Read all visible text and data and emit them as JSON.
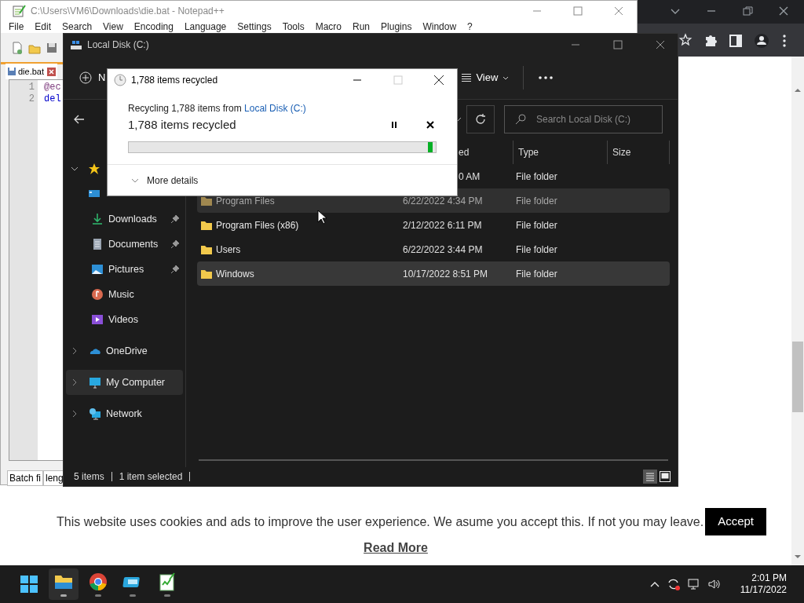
{
  "notepad": {
    "title": "C:\\Users\\VM6\\Downloads\\die.bat - Notepad++",
    "menu": [
      "File",
      "Edit",
      "Search",
      "View",
      "Encoding",
      "Language",
      "Settings",
      "Tools",
      "Macro",
      "Run",
      "Plugins",
      "Window",
      "?"
    ],
    "tab": {
      "label": "die.bat"
    },
    "lines": [
      {
        "number": "1",
        "code": "@ec"
      },
      {
        "number": "2",
        "code": "del"
      }
    ],
    "status": [
      "Batch fi",
      "leng"
    ]
  },
  "cookie_banner": {
    "text": "This website uses cookies and ads to improve the user experience. We asume you accept this. If not you may leave.",
    "button": "Accept",
    "link": "Read More"
  },
  "explorer": {
    "title": "Local Disk (C:)",
    "commands": [
      {
        "kind": "new",
        "label": "N"
      },
      {
        "kind": "view",
        "label": "View"
      },
      {
        "kind": "more"
      }
    ],
    "search": {
      "placeholder": "Search Local Disk (C:)"
    },
    "columns": [
      "ed",
      "Type",
      "Size"
    ],
    "rows": [
      {
        "date": "0 AM",
        "type": "File folder",
        "selected": false,
        "hovered": false,
        "dimmed": false
      },
      {
        "name": "Program Files",
        "date": "6/22/2022 4:34 PM",
        "type": "File folder",
        "selected": false,
        "hovered": true,
        "dimmed": true
      },
      {
        "name": "Program Files (x86)",
        "date": "2/12/2022 6:11 PM",
        "type": "File folder",
        "selected": false,
        "hovered": false,
        "dimmed": false
      },
      {
        "name": "Users",
        "date": "6/22/2022 3:44 PM",
        "type": "File folder",
        "selected": false,
        "hovered": false,
        "dimmed": false
      },
      {
        "name": "Windows",
        "date": "10/17/2022 8:51 PM",
        "type": "File folder",
        "selected": true,
        "hovered": false,
        "dimmed": false
      }
    ],
    "sidebar": [
      {
        "kind": "star",
        "expanded": true,
        "selected": false
      },
      {
        "kind": "desktop",
        "selected": false
      },
      {
        "kind": "downloads",
        "label": "Downloads",
        "pinned": true,
        "selected": false
      },
      {
        "kind": "documents",
        "label": "Documents",
        "pinned": true,
        "selected": false
      },
      {
        "kind": "pictures",
        "label": "Pictures",
        "pinned": true,
        "selected": false
      },
      {
        "kind": "music",
        "label": "Music",
        "pinned": false,
        "selected": false
      },
      {
        "kind": "videos",
        "label": "Videos",
        "pinned": false,
        "selected": false
      },
      {
        "kind": "onedrive",
        "label": "OneDrive",
        "expanded": false,
        "selected": false
      },
      {
        "kind": "computer",
        "label": "My Computer",
        "expanded": false,
        "selected": true
      },
      {
        "kind": "network",
        "label": "Network",
        "expanded": false,
        "selected": false
      }
    ],
    "status": [
      "5 items",
      "1 item selected"
    ]
  },
  "dialog": {
    "title": "1,788 items recycled",
    "source_prefix": "Recycling 1,788 items from ",
    "source_link": "Local Disk (C:)",
    "heading": "1,788 items recycled",
    "progress": {
      "level": 0.99
    },
    "details": "More details"
  },
  "taskbar": {
    "apps": [
      {
        "kind": "start",
        "active": false
      },
      {
        "kind": "explorer",
        "active": true
      },
      {
        "kind": "chrome",
        "active": false
      },
      {
        "kind": "app",
        "active": false
      },
      {
        "kind": "notepad",
        "active": false
      }
    ],
    "time": "2:01 PM",
    "date": "11/17/2022"
  }
}
